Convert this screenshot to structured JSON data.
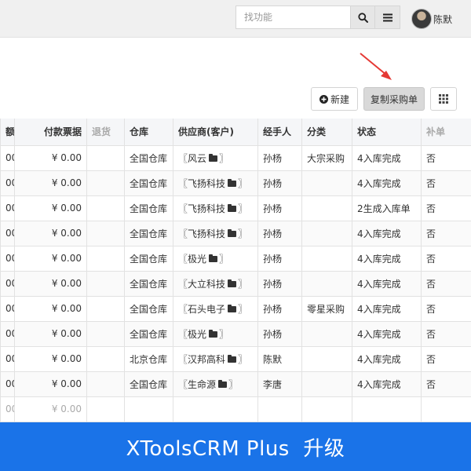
{
  "topbar": {
    "search_placeholder": "找功能",
    "user_name": "陈默",
    "icons": {
      "search": "search-icon",
      "menu": "menu-icon"
    }
  },
  "toolbar": {
    "new_label": "新建",
    "copy_label": "复制采购单",
    "icons": {
      "new": "plus-circle-icon",
      "grid": "grid-icon",
      "pointer": "arrow-pointer-icon"
    }
  },
  "table": {
    "columns": [
      "额",
      "付款票据",
      "退货",
      "仓库",
      "供应商(客户)",
      "经手人",
      "分类",
      "状态",
      "补单"
    ],
    "rows": [
      [
        "00",
        "¥ 0.00",
        "",
        "全国仓库",
        "〖风云",
        "孙杨",
        "大宗采购",
        "4入库完成",
        "否"
      ],
      [
        "00",
        "¥ 0.00",
        "",
        "全国仓库",
        "〖飞扬科技",
        "孙杨",
        "",
        "4入库完成",
        "否"
      ],
      [
        "00",
        "¥ 0.00",
        "",
        "全国仓库",
        "〖飞扬科技",
        "孙杨",
        "",
        "2生成入库单",
        "否"
      ],
      [
        "00",
        "¥ 0.00",
        "",
        "全国仓库",
        "〖飞扬科技",
        "孙杨",
        "",
        "4入库完成",
        "否"
      ],
      [
        "00",
        "¥ 0.00",
        "",
        "全国仓库",
        "〖极光",
        "孙杨",
        "",
        "4入库完成",
        "否"
      ],
      [
        "00",
        "¥ 0.00",
        "",
        "全国仓库",
        "〖大立科技",
        "孙杨",
        "",
        "4入库完成",
        "否"
      ],
      [
        "00",
        "¥ 0.00",
        "",
        "全国仓库",
        "〖石头电子",
        "孙杨",
        "零星采购",
        "4入库完成",
        "否"
      ],
      [
        "00",
        "¥ 0.00",
        "",
        "全国仓库",
        "〖极光",
        "孙杨",
        "",
        "4入库完成",
        "否"
      ],
      [
        "00",
        "¥ 0.00",
        "",
        "北京仓库",
        "〖汉邦高科",
        "陈默",
        "",
        "4入库完成",
        "否"
      ],
      [
        "00",
        "¥ 0.00",
        "",
        "全国仓库",
        "〖生命源",
        "李唐",
        "",
        "4入库完成",
        "否"
      ]
    ],
    "supplier_suffix": "〗",
    "totals": [
      "00",
      "¥ 0.00",
      "",
      "",
      "",
      "",
      "",
      "",
      ""
    ]
  },
  "banner": {
    "text": "XToolsCRM Plus  升级"
  },
  "colors": {
    "banner": "#1a73e8",
    "arrow": "#e53935",
    "header_bg": "#f5f6f8"
  }
}
